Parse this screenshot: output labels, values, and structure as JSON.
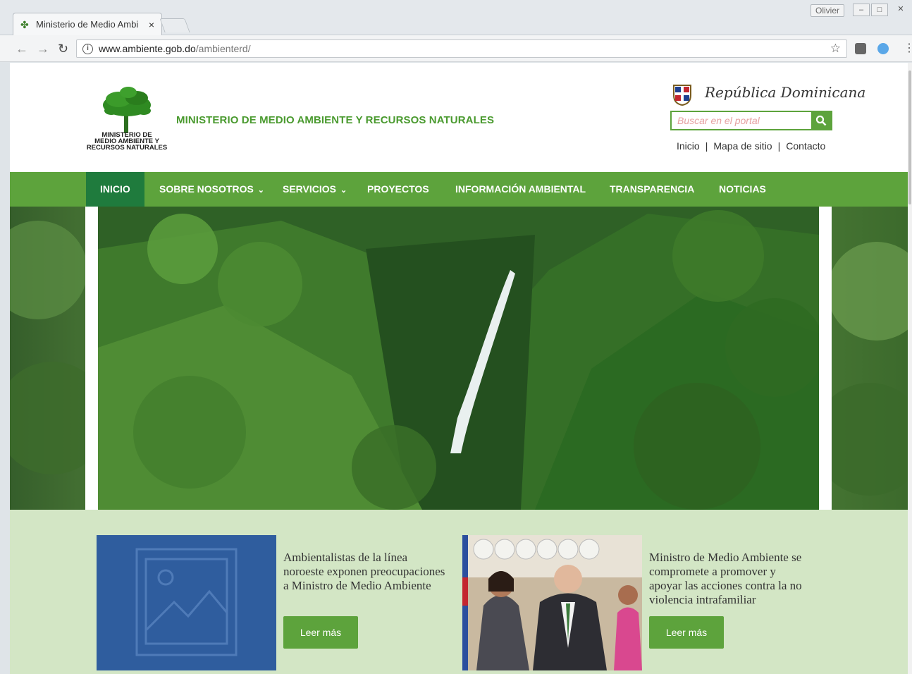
{
  "browser": {
    "tab_title": "Ministerio de Medio Ambi",
    "tab_close": "×",
    "profile_name": "Olivier",
    "url_host": "www.ambiente.gob.do",
    "url_path": "/ambienterd/"
  },
  "header": {
    "logo_text_line1": "MINISTERIO DE",
    "logo_text_line2": "MEDIO AMBIENTE Y",
    "logo_text_line3": "RECURSOS NATURALES",
    "ministry_title": "MINISTERIO DE MEDIO AMBIENTE Y RECURSOS NATURALES",
    "republic_text": "República Dominicana",
    "search_placeholder": "Buscar en el portal",
    "links": [
      "Inicio",
      "Mapa de sitio",
      "Contacto"
    ],
    "link_separator": "|"
  },
  "nav": {
    "items": [
      {
        "label": "INICIO",
        "active": true,
        "dropdown": false
      },
      {
        "label": "SOBRE NOSOTROS",
        "active": false,
        "dropdown": true
      },
      {
        "label": "SERVICIOS",
        "active": false,
        "dropdown": true
      },
      {
        "label": "PROYECTOS",
        "active": false,
        "dropdown": false
      },
      {
        "label": "INFORMACIÓN AMBIENTAL",
        "active": false,
        "dropdown": false
      },
      {
        "label": "TRANSPARENCIA",
        "active": false,
        "dropdown": false
      },
      {
        "label": "NOTICIAS",
        "active": false,
        "dropdown": false
      }
    ]
  },
  "news": [
    {
      "title": "Ambientalistas de la línea noroeste exponen preocupaciones a Ministro de Medio Ambiente",
      "button": "Leer más"
    },
    {
      "title": "Ministro de Medio Ambiente se compromete a promover y apoyar las acciones contra la no violencia intrafamiliar",
      "button": "Leer más"
    }
  ],
  "colors": {
    "brand_green": "#5da33c",
    "active_green": "#1f7b3d",
    "news_bg": "#d3e6c5",
    "placeholder_blue": "#2f5d9e"
  }
}
